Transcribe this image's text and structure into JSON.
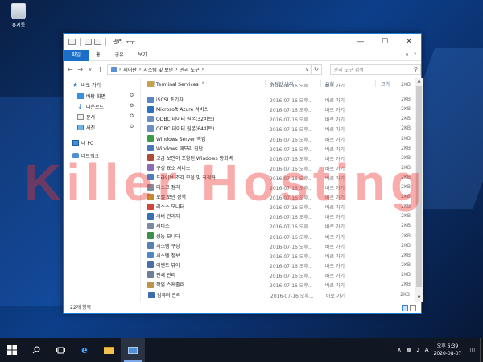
{
  "desktop": {
    "recycle_bin_label": "휴지통"
  },
  "watermark": "Killer Hosting",
  "window": {
    "title": "관리 도구",
    "ribbon_tabs": [
      "파일",
      "홈",
      "공유",
      "보기"
    ],
    "breadcrumb": [
      "제어판",
      "시스템 및 보안",
      "관리 도구"
    ],
    "search_placeholder": "관리 도구 검색",
    "columns": {
      "name": "이름",
      "date": "수정한 날짜",
      "type": "유형",
      "size": "크기"
    },
    "nav_items": [
      {
        "label": "바로 가기",
        "icon": "star-icon"
      },
      {
        "label": "바탕 화면",
        "icon": "desktop-icon"
      },
      {
        "label": "다운로드",
        "icon": "download-icon"
      },
      {
        "label": "문서",
        "icon": "document-icon"
      },
      {
        "label": "사진",
        "icon": "picture-icon"
      },
      {
        "label": "내 PC",
        "icon": "pc-icon"
      },
      {
        "label": "네트워크",
        "icon": "network-icon"
      }
    ],
    "files": [
      {
        "name": "Terminal Services",
        "date": "2016-07-16 오후...",
        "type": "바로 가기",
        "size": "2KB",
        "color": "#c9a14a"
      },
      {
        "name": "iSCSI 초기자",
        "date": "2016-07-16 오후...",
        "type": "바로 가기",
        "size": "2KB",
        "color": "#5a86c4"
      },
      {
        "name": "Microsoft Azure 서비스",
        "date": "2016-07-16 오후...",
        "type": "바로 가기",
        "size": "2KB",
        "color": "#2f6fc4"
      },
      {
        "name": "ODBC 데이터 원본(32비트)",
        "date": "2016-07-16 오후...",
        "type": "바로 가기",
        "size": "2KB",
        "color": "#6b8fc2"
      },
      {
        "name": "ODBC 데이터 원본(64비트)",
        "date": "2016-07-16 오후...",
        "type": "바로 가기",
        "size": "2KB",
        "color": "#6b8fc2"
      },
      {
        "name": "Windows Server 백업",
        "date": "2016-07-16 오후...",
        "type": "바로 가기",
        "size": "2KB",
        "color": "#3d9a4b"
      },
      {
        "name": "Windows 메모리 진단",
        "date": "2016-07-16 오후...",
        "type": "바로 가기",
        "size": "2KB",
        "color": "#4a78b8"
      },
      {
        "name": "고급 보안이 포함된 Windows 방화벽",
        "date": "2016-07-16 오후...",
        "type": "바로 가기",
        "size": "2KB",
        "color": "#b24a3a"
      },
      {
        "name": "구성 요소 서비스",
        "date": "2016-07-16 오후...",
        "type": "바로 가기",
        "size": "2KB",
        "color": "#8a6bb8"
      },
      {
        "name": "드라이브 조각 모음 및 최적화",
        "date": "2016-07-16 오후...",
        "type": "바로 가기",
        "size": "2KB",
        "color": "#4e7cc0"
      },
      {
        "name": "디스크 정리",
        "date": "2016-07-16 오후...",
        "type": "바로 가기",
        "size": "2KB",
        "color": "#7c8ea6"
      },
      {
        "name": "로컬 보안 정책",
        "date": "2016-07-16 오후...",
        "type": "바로 가기",
        "size": "2KB",
        "color": "#c48a2f"
      },
      {
        "name": "리소스 모니터",
        "date": "2016-07-16 오후...",
        "type": "바로 가기",
        "size": "2KB",
        "color": "#d0463b"
      },
      {
        "name": "서버 관리자",
        "date": "2016-07-16 오후...",
        "type": "바로 가기",
        "size": "2KB",
        "color": "#3b6fb5"
      },
      {
        "name": "서비스",
        "date": "2016-07-16 오후...",
        "type": "바로 가기",
        "size": "2KB",
        "color": "#7a8aa0"
      },
      {
        "name": "성능 모니터",
        "date": "2016-07-16 오후...",
        "type": "바로 가기",
        "size": "2KB",
        "color": "#3f8f4a"
      },
      {
        "name": "시스템 구성",
        "date": "2016-07-16 오후...",
        "type": "바로 가기",
        "size": "2KB",
        "color": "#5a7fb2"
      },
      {
        "name": "시스템 정보",
        "date": "2016-07-16 오후...",
        "type": "바로 가기",
        "size": "2KB",
        "color": "#4f86c6"
      },
      {
        "name": "이벤트 뷰어",
        "date": "2016-07-16 오후...",
        "type": "바로 가기",
        "size": "2KB",
        "color": "#4a6fa8"
      },
      {
        "name": "인쇄 관리",
        "date": "2016-07-16 오후...",
        "type": "바로 가기",
        "size": "2KB",
        "color": "#6e7f95"
      },
      {
        "name": "작업 스케줄러",
        "date": "2016-07-16 오후...",
        "type": "바로 가기",
        "size": "2KB",
        "color": "#b8954a"
      },
      {
        "name": "컴퓨터 관리",
        "date": "2016-07-16 오후...",
        "type": "바로 가기",
        "size": "2KB",
        "color": "#3e6bb0"
      }
    ],
    "highlighted_file": "컴퓨터 관리",
    "status": "22개 항목"
  },
  "taskbar": {
    "time": "오후 6:39",
    "date": "2020-08-07",
    "ime": "A"
  }
}
